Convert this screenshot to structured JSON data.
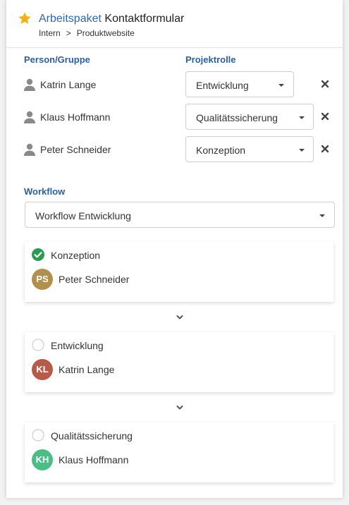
{
  "header": {
    "type_label": "Arbeitspaket",
    "title": "Kontaktformular",
    "breadcrumb": [
      "Intern",
      "Produktwebsite"
    ],
    "breadcrumb_separator": ">",
    "star_icon": "star-icon",
    "star_color": "#f2b01e"
  },
  "columns": {
    "person": "Person/Gruppe",
    "role": "Projektrolle"
  },
  "assignments": [
    {
      "person": "Katrin Lange",
      "role": "Entwicklung"
    },
    {
      "person": "Klaus Hoffmann",
      "role": "Qualitätssicherung"
    },
    {
      "person": "Peter Schneider",
      "role": "Konzeption"
    }
  ],
  "workflow": {
    "label": "Workflow",
    "selected": "Workflow Entwicklung",
    "steps": [
      {
        "name": "Konzeption",
        "done": true,
        "person": "Peter Schneider",
        "initials": "PS",
        "avatar_color": "#b08f4f"
      },
      {
        "name": "Entwicklung",
        "done": false,
        "person": "Katrin Lange",
        "initials": "KL",
        "avatar_color": "#b85a4a"
      },
      {
        "name": "Qualitätssicherung",
        "done": false,
        "person": "Klaus Hoffmann",
        "initials": "KH",
        "avatar_color": "#4bbd86"
      }
    ]
  },
  "colors": {
    "accent": "#3466a3",
    "heading": "#2e5f96",
    "check": "#2d9a54"
  }
}
